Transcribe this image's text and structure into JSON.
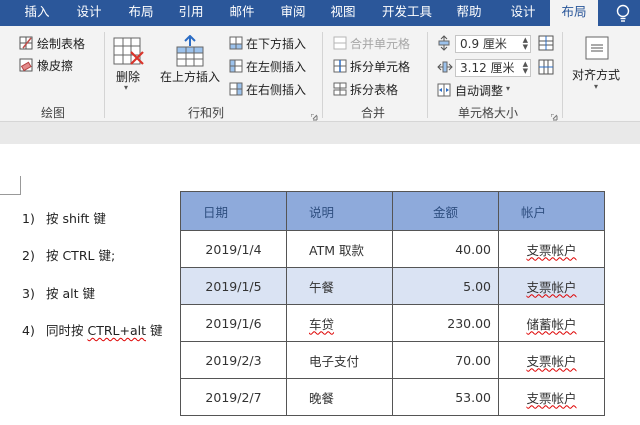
{
  "tabs": [
    {
      "id": "insert",
      "label": "插入"
    },
    {
      "id": "design",
      "label": "设计"
    },
    {
      "id": "layout",
      "label": "布局"
    },
    {
      "id": "references",
      "label": "引用"
    },
    {
      "id": "mailings",
      "label": "邮件"
    },
    {
      "id": "review",
      "label": "审阅"
    },
    {
      "id": "view",
      "label": "视图"
    },
    {
      "id": "developer",
      "label": "开发工具"
    },
    {
      "id": "help",
      "label": "帮助"
    },
    {
      "id": "table_design",
      "label": "设计"
    },
    {
      "id": "table_layout",
      "label": "布局"
    }
  ],
  "ribbon": {
    "draw": {
      "label": "绘图",
      "draw_table": "绘制表格",
      "eraser": "橡皮擦"
    },
    "rows_cols": {
      "label": "行和列",
      "delete": "删除",
      "insert_above": "在上方插入",
      "insert_below": "在下方插入",
      "insert_left": "在左侧插入",
      "insert_right": "在右侧插入"
    },
    "merge": {
      "label": "合并",
      "merge_cells": "合并单元格",
      "split_cells": "拆分单元格",
      "split_table": "拆分表格"
    },
    "cell_size": {
      "label": "单元格大小",
      "height": "0.9 厘米",
      "width": "3.12 厘米",
      "autofit": "自动调整"
    },
    "alignment": {
      "label": "对齐方式"
    }
  },
  "list": [
    {
      "num": "1)",
      "text": "按 shift 键"
    },
    {
      "num": "2)",
      "text": "按 CTRL 键;"
    },
    {
      "num": "3)",
      "text": "按 alt 键"
    },
    {
      "num": "4)",
      "text_pre": "同时按 ",
      "text_mid": "CTRL+alt",
      "text_post": " 键"
    }
  ],
  "table": {
    "headers": {
      "date": "日期",
      "desc": "说明",
      "amount": "金额",
      "account": "帐户"
    },
    "rows": [
      {
        "date": "2019/1/4",
        "desc": "ATM 取款",
        "amount": "40.00",
        "account": "支票帐户"
      },
      {
        "date": "2019/1/5",
        "desc": "午餐",
        "amount": "5.00",
        "account": "支票帐户"
      },
      {
        "date": "2019/1/6",
        "desc": "车贷",
        "amount": "230.00",
        "account": "储蓄帐户"
      },
      {
        "date": "2019/2/3",
        "desc": "电子支付",
        "amount": "70.00",
        "account": "支票帐户"
      },
      {
        "date": "2019/2/7",
        "desc": "晚餐",
        "amount": "53.00",
        "account": "支票帐户"
      }
    ]
  }
}
